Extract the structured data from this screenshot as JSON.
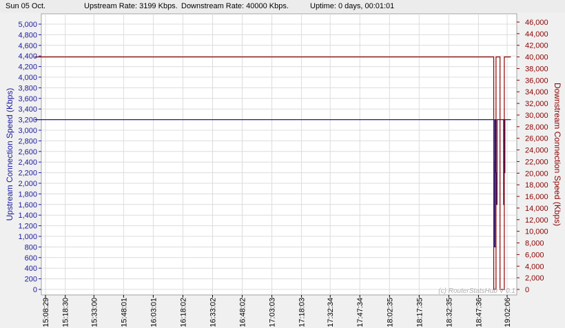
{
  "status": {
    "date": "Sun 05 Oct.",
    "upstream": "Upstream Rate: 3199 Kbps.",
    "downstream": "Downstream Rate: 40000 Kbps.",
    "uptime": "Uptime: 0 days, 00:01:01"
  },
  "chart_data": {
    "type": "line",
    "ylabel_left": "Upstream Connection Speed (Kbps)",
    "ylabel_right": "Downstream Connection Speed (Kbps)",
    "watermark": "(c) RouterStatsHub V 0.1",
    "y_left": {
      "min": 0,
      "max": 5000,
      "ticks": [
        "0",
        "200",
        "400",
        "600",
        "800",
        "1,000",
        "1,200",
        "1,400",
        "1,600",
        "1,800",
        "2,000",
        "2,200",
        "2,400",
        "2,600",
        "2,800",
        "3,000",
        "3,200",
        "3,400",
        "3,600",
        "3,800",
        "4,000",
        "4,200",
        "4,400",
        "4,600",
        "4,800",
        "5,000"
      ]
    },
    "y_right": {
      "min": 0,
      "max": 46000,
      "ticks": [
        "0",
        "2,000",
        "4,000",
        "6,000",
        "8,000",
        "10,000",
        "12,000",
        "14,000",
        "16,000",
        "18,000",
        "20,000",
        "22,000",
        "24,000",
        "26,000",
        "28,000",
        "30,000",
        "32,000",
        "34,000",
        "36,000",
        "38,000",
        "40,000",
        "42,000",
        "44,000",
        "46,000"
      ]
    },
    "x_ticks": [
      "15:08:29",
      "15:18:30",
      "15:33:00",
      "15:48:01",
      "16:03:01",
      "16:18:02",
      "16:33:02",
      "16:48:02",
      "17:03:03",
      "17:18:03",
      "17:32:34",
      "17:47:34",
      "18:02:35",
      "18:17:35",
      "18:32:35",
      "18:47:36",
      "19:02:06"
    ],
    "colors": {
      "upstream": "#1a1a80",
      "downstream": "#8b0000",
      "grid": "#dcdcdc"
    },
    "series": [
      {
        "name": "Upstream",
        "axis": "left",
        "color": "#1a1a80",
        "points": [
          [
            "15:03:00",
            3200
          ],
          [
            "18:55:30",
            3200
          ],
          [
            "18:55:30",
            2400
          ],
          [
            "18:55:45",
            2400
          ],
          [
            "18:55:45",
            800
          ],
          [
            "18:56:00",
            800
          ],
          [
            "18:56:00",
            3200
          ],
          [
            "18:56:20",
            3200
          ],
          [
            "18:56:20",
            2200
          ],
          [
            "18:56:40",
            2200
          ],
          [
            "18:56:40",
            1600
          ],
          [
            "18:57:00",
            1600
          ],
          [
            "18:57:00",
            3200
          ],
          [
            "19:00:20",
            3200
          ],
          [
            "19:00:20",
            1600
          ],
          [
            "19:00:40",
            1600
          ],
          [
            "19:00:40",
            2200
          ],
          [
            "19:01:00",
            2200
          ],
          [
            "19:01:00",
            3200
          ],
          [
            "19:04:00",
            3200
          ]
        ]
      },
      {
        "name": "Downstream",
        "axis": "right",
        "color": "#8b0000",
        "points": [
          [
            "15:03:00",
            40000
          ],
          [
            "18:55:20",
            40000
          ],
          [
            "18:55:20",
            0
          ],
          [
            "18:56:30",
            0
          ],
          [
            "18:56:30",
            40000
          ],
          [
            "18:58:30",
            40000
          ],
          [
            "18:58:30",
            0
          ],
          [
            "19:00:40",
            0
          ],
          [
            "19:00:40",
            40000
          ],
          [
            "19:04:00",
            40000
          ]
        ]
      }
    ]
  }
}
